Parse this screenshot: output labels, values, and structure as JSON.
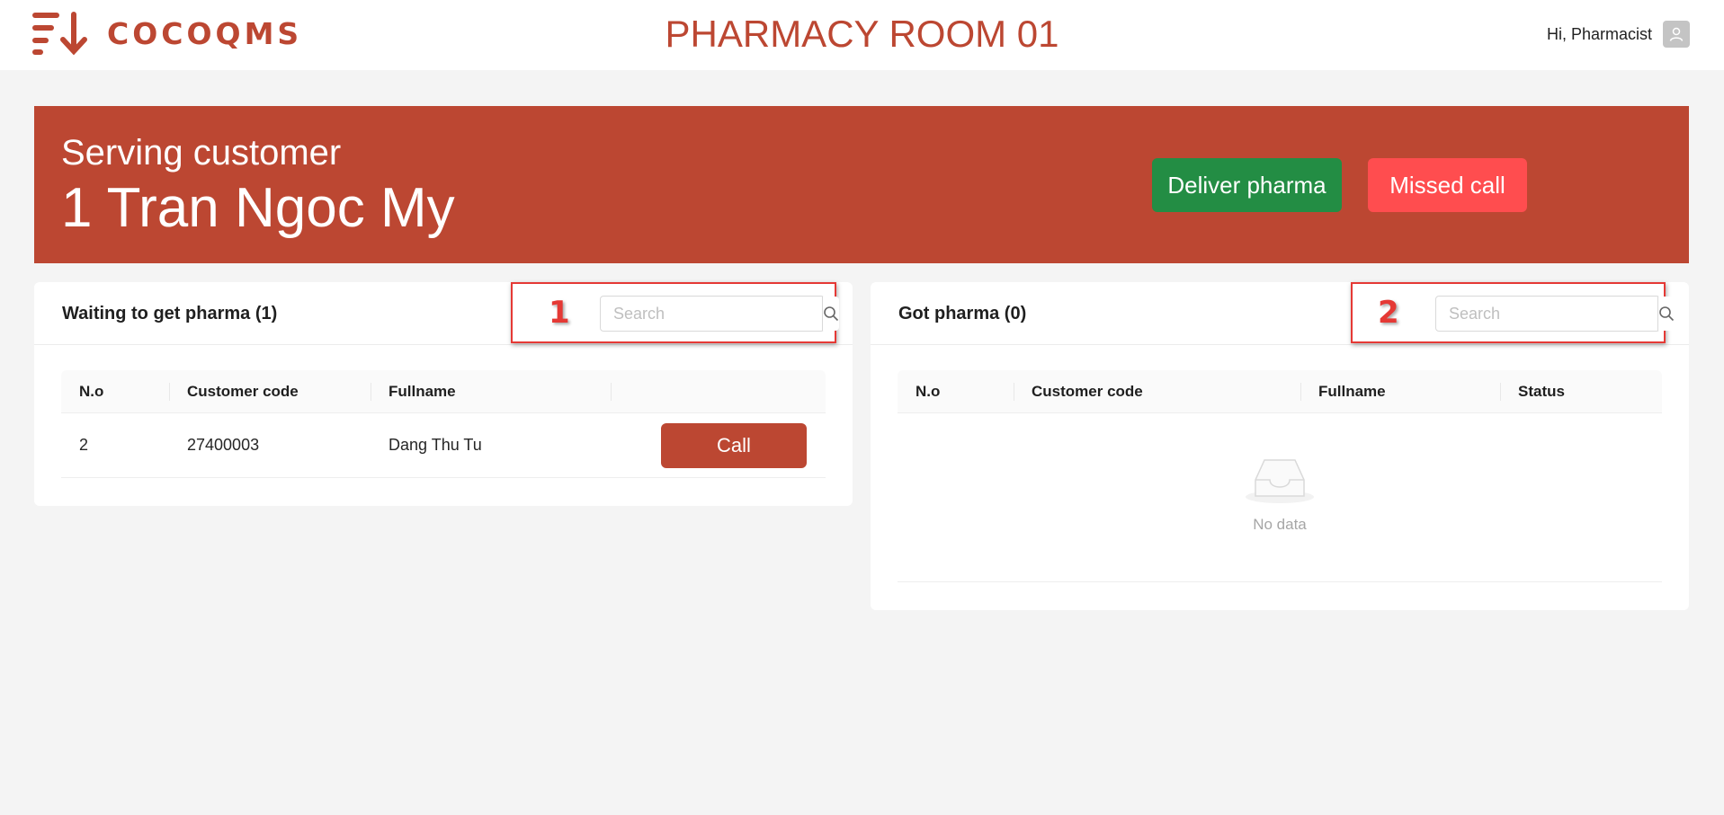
{
  "header": {
    "logo_text": "COCOQMS",
    "title": "PHARMACY ROOM 01",
    "greeting": "Hi, Pharmacist"
  },
  "banner": {
    "label": "Serving customer",
    "customer": "1 Tran Ngoc My",
    "deliver_label": "Deliver pharma",
    "missed_label": "Missed call"
  },
  "waiting": {
    "title": "Waiting to get pharma (1)",
    "annotation": "1",
    "search_placeholder": "Search",
    "columns": [
      "N.o",
      "Customer code",
      "Fullname",
      ""
    ],
    "rows": [
      {
        "no": "2",
        "code": "27400003",
        "name": "Dang Thu Tu",
        "action": "Call"
      }
    ]
  },
  "got": {
    "title": "Got pharma (0)",
    "annotation": "2",
    "search_placeholder": "Search",
    "columns": [
      "N.o",
      "Customer code",
      "Fullname",
      "Status"
    ],
    "empty_text": "No data"
  },
  "colors": {
    "brand": "#bc4732",
    "deliver": "#238d44",
    "missed": "#ff4d4f",
    "annotation": "#e53935"
  },
  "icons": [
    "logo-icon",
    "user-icon",
    "search-icon",
    "inbox-empty-icon"
  ]
}
